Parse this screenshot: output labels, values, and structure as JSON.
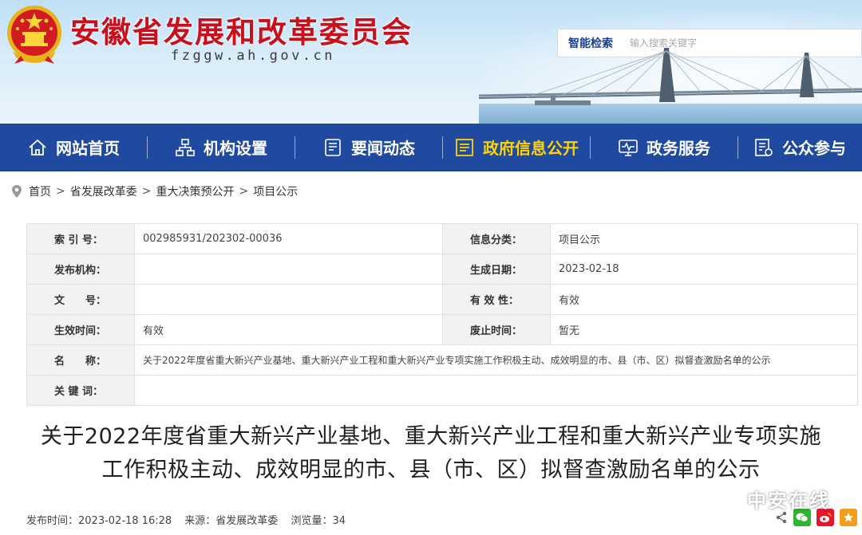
{
  "header": {
    "site_title": "安徽省发展和改革委员会",
    "site_domain": "fzggw.ah.gov.cn",
    "search_label": "智能检索",
    "search_placeholder": "输入搜索关键字"
  },
  "nav": {
    "items": [
      {
        "label": "网站首页",
        "icon": "home-icon",
        "active": false
      },
      {
        "label": "机构设置",
        "icon": "org-chart-icon",
        "active": false
      },
      {
        "label": "要闻动态",
        "icon": "news-icon",
        "active": false
      },
      {
        "label": "政府信息公开",
        "icon": "document-list-icon",
        "active": true
      },
      {
        "label": "政务服务",
        "icon": "monitor-icon",
        "active": false
      },
      {
        "label": "公众参与",
        "icon": "participation-icon",
        "active": false
      }
    ],
    "active_color": "#ffd400",
    "bar_color": "#1f4aa0"
  },
  "breadcrumb": {
    "items": [
      "首页",
      "省发展改革委",
      "重大决策预公开",
      "项目公示"
    ],
    "separator": ">"
  },
  "info_table": {
    "index_no_label": "索 引 号：",
    "index_no": "002985931/202302-00036",
    "category_label": "信息分类：",
    "category": "项目公示",
    "publisher_label": "发布机构：",
    "publisher": "",
    "created_label": "生成日期：",
    "created": "2023-02-18",
    "doc_no_label": "文　　号：",
    "doc_no": "",
    "validity_label": "有 效 性：",
    "validity": "有效",
    "effective_label": "生效时间：",
    "effective": "有效",
    "expire_label": "废止时间：",
    "expire": "暂无",
    "name_label": "名　　称：",
    "name": "关于2022年度省重大新兴产业基地、重大新兴产业工程和重大新兴产业专项实施工作积极主动、成效明显的市、县（市、区）拟督查激励名单的公示",
    "keywords_label": "关 键 词：",
    "keywords": ""
  },
  "article": {
    "title_line1": "关于2022年度省重大新兴产业基地、重大新兴产业工程和重大新兴产业专项实施",
    "title_line2": "工作积极主动、成效明显的市、县（市、区）拟督查激励名单的公示",
    "publish_time": "发布时间：2023-02-18 16:28",
    "source": "来源：省发展改革委",
    "views": "浏览量：34"
  },
  "watermark": {
    "text": "中安在线"
  }
}
